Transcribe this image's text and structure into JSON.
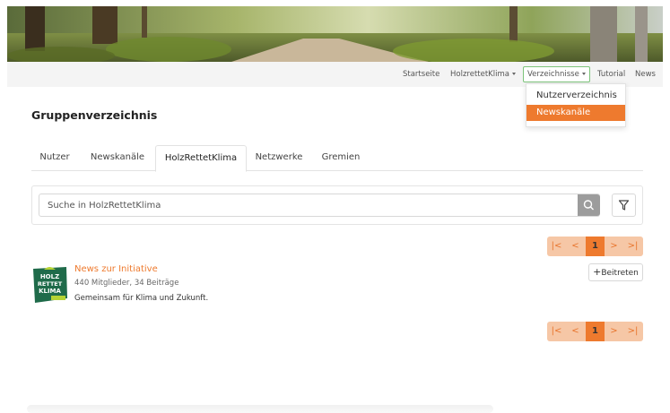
{
  "nav": {
    "items": [
      {
        "label": "Startseite"
      },
      {
        "label": "HolzrettetKlima"
      },
      {
        "label": "Verzeichnisse"
      },
      {
        "label": "Tutorial"
      },
      {
        "label": "News"
      }
    ],
    "dropdown": [
      "Nutzerverzeichnis",
      "Newskanäle"
    ]
  },
  "page": {
    "title": "Gruppenverzeichnis"
  },
  "tabs": [
    "Nutzer",
    "Newskanäle",
    "HolzRettetKlima",
    "Netzwerke",
    "Gremien"
  ],
  "search": {
    "placeholder": "Suche in HolzRettetKlima"
  },
  "pagination": {
    "first": "|<",
    "prev": "<",
    "current": "1",
    "next": ">",
    "last": ">|"
  },
  "group": {
    "title": "News zur Initiative",
    "meta": "440 Mitglieder, 34 Beiträge",
    "description": "Gemeinsam für Klima und Zukunft.",
    "join_label": "Beitreten",
    "logo_lines": [
      "HOLZ",
      "RETTET",
      "KLIMA"
    ]
  },
  "colors": {
    "accent": "#ee7a2e",
    "accent_light": "#f6c7a6",
    "logo_green": "#1f6b4a",
    "logo_lime": "#b5d334"
  }
}
